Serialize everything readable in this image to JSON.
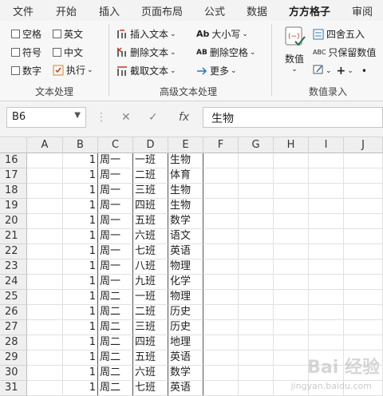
{
  "tabs": [
    "文件",
    "开始",
    "插入",
    "页面布局",
    "公式",
    "数据",
    "方方格子",
    "审阅"
  ],
  "active_tab_index": 6,
  "ribbon": {
    "text_group": {
      "items": [
        "空格",
        "英文",
        "符号",
        "中文",
        "数字",
        "执行"
      ],
      "label": "文本处理"
    },
    "advanced_group": {
      "items": [
        "插入文本",
        "删除文本",
        "截取文本",
        "大小写",
        "删除空格",
        "更多"
      ],
      "label": "高级文本处理"
    },
    "numeric_group": {
      "big_button": "数值",
      "items": [
        "四舍五入",
        "只保留数值"
      ],
      "label": "数值录入"
    }
  },
  "formula_bar": {
    "name_box": "B6",
    "content": "生物",
    "fx": "fx"
  },
  "grid": {
    "columns": [
      "A",
      "B",
      "C",
      "D",
      "E",
      "F",
      "G",
      "H",
      "I",
      "J"
    ],
    "rows": [
      {
        "n": "16",
        "b": "1",
        "c": "周一",
        "d": "一班",
        "e": "生物"
      },
      {
        "n": "17",
        "b": "1",
        "c": "周一",
        "d": "二班",
        "e": "体育"
      },
      {
        "n": "18",
        "b": "1",
        "c": "周一",
        "d": "三班",
        "e": "生物"
      },
      {
        "n": "19",
        "b": "1",
        "c": "周一",
        "d": "四班",
        "e": "生物"
      },
      {
        "n": "20",
        "b": "1",
        "c": "周一",
        "d": "五班",
        "e": "数学"
      },
      {
        "n": "21",
        "b": "1",
        "c": "周一",
        "d": "六班",
        "e": "语文"
      },
      {
        "n": "22",
        "b": "1",
        "c": "周一",
        "d": "七班",
        "e": "英语"
      },
      {
        "n": "23",
        "b": "1",
        "c": "周一",
        "d": "八班",
        "e": "物理"
      },
      {
        "n": "24",
        "b": "1",
        "c": "周一",
        "d": "九班",
        "e": "化学"
      },
      {
        "n": "25",
        "b": "1",
        "c": "周二",
        "d": "一班",
        "e": "物理"
      },
      {
        "n": "26",
        "b": "1",
        "c": "周二",
        "d": "二班",
        "e": "历史"
      },
      {
        "n": "27",
        "b": "1",
        "c": "周二",
        "d": "三班",
        "e": "历史"
      },
      {
        "n": "28",
        "b": "1",
        "c": "周二",
        "d": "四班",
        "e": "地理"
      },
      {
        "n": "29",
        "b": "1",
        "c": "周二",
        "d": "五班",
        "e": "英语"
      },
      {
        "n": "30",
        "b": "1",
        "c": "周二",
        "d": "六班",
        "e": "数学"
      },
      {
        "n": "31",
        "b": "1",
        "c": "周二",
        "d": "七班",
        "e": "英语"
      }
    ]
  },
  "watermark": {
    "main": "Bai 经验",
    "sub": "jingyan.baidu.com"
  },
  "colors": {
    "accent": "#217346",
    "icon_red": "#c0392b",
    "icon_blue": "#2e75b6"
  }
}
